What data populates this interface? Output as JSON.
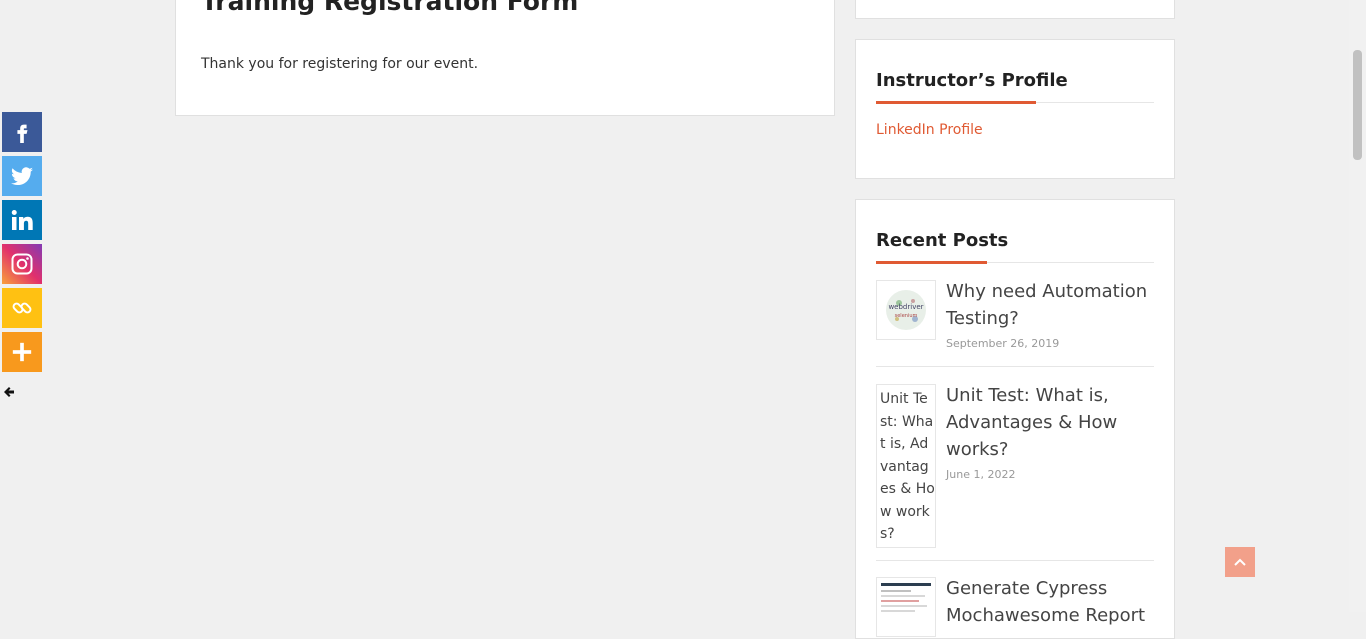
{
  "main": {
    "title": "Training Registration Form",
    "message": "Thank you for registering for our event."
  },
  "sidebar": {
    "profile": {
      "title": "Instructor’s Profile",
      "link_label": "LinkedIn Profile"
    },
    "recent_posts": {
      "title": "Recent Posts",
      "items": [
        {
          "title": "Why need Automation Testing?",
          "date": "September 26, 2019",
          "thumb_words": [
            "webdriver",
            "selenium"
          ]
        },
        {
          "title": "Unit Test: What is, Advantages & How works?",
          "date": "June 1, 2022",
          "thumb_alt": "Unit Test: What is, Advantages & How works?"
        },
        {
          "title": "Generate Cypress Mochawesome Report"
        }
      ]
    }
  },
  "share_bar": {
    "buttons": [
      {
        "name": "facebook",
        "color": "#3b5998",
        "icon": "facebook-icon"
      },
      {
        "name": "twitter",
        "color": "#55acee",
        "icon": "twitter-icon"
      },
      {
        "name": "linkedin",
        "color": "#0077b5",
        "icon": "linkedin-icon"
      },
      {
        "name": "instagram",
        "color": "#c32aa3",
        "icon": "instagram-icon"
      },
      {
        "name": "copy-link",
        "color": "#ffc112",
        "icon": "link-icon"
      },
      {
        "name": "more",
        "color": "#f8991d",
        "icon": "plus-icon"
      }
    ]
  },
  "colors": {
    "accent": "#e05a33",
    "scroll_top_button": "#f2a08a"
  }
}
